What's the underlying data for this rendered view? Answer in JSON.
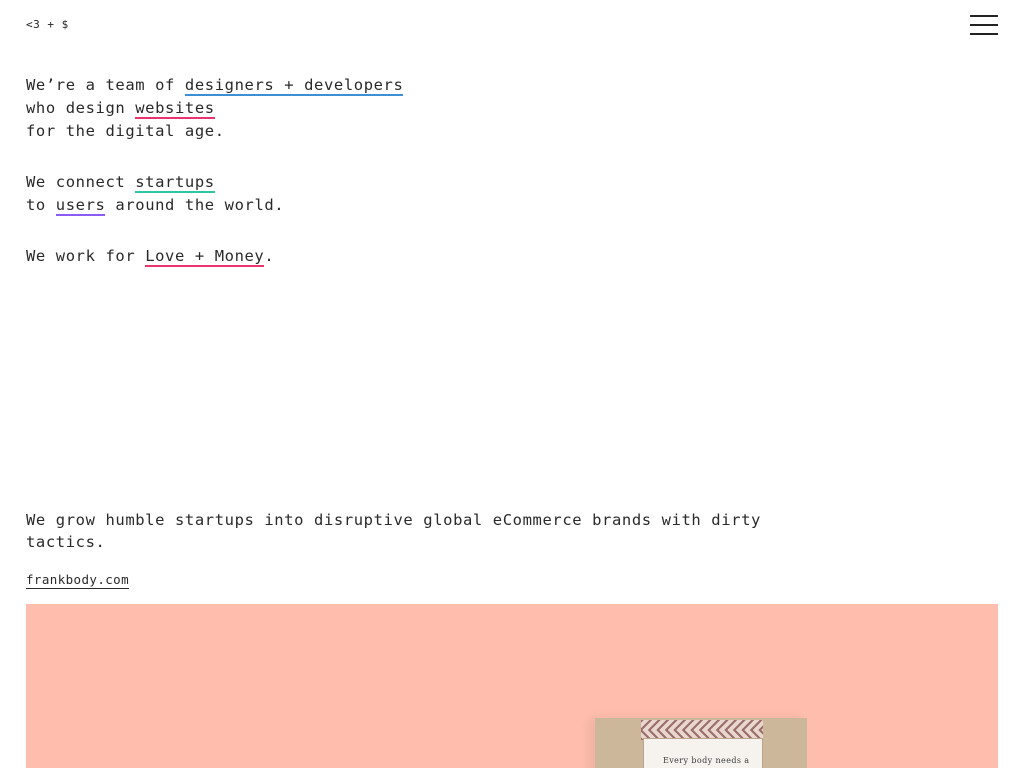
{
  "header": {
    "logo_text": "<3 + $",
    "menu_icon": "hamburger-menu-icon"
  },
  "intro": {
    "p1": {
      "l1_pre": "We’re a team of ",
      "l1_link": "designers + developers",
      "l2_pre": "who design ",
      "l2_link": "websites",
      "l3": "for the digital age."
    },
    "p2": {
      "l1_pre": "We connect ",
      "l1_link": "startups",
      "l2_pre": "to ",
      "l2_link": "users",
      "l2_post": " around the world."
    },
    "p3": {
      "pre": "We work for ",
      "link": "Love + Money",
      "post": "."
    }
  },
  "colors": {
    "designers_developers": "#3d8fd6",
    "websites": "#e8356e",
    "startups": "#2cc6a3",
    "users": "#8c5bf5",
    "love_money": "#e8356e",
    "hero_background": "#febdad"
  },
  "showcase": {
    "tagline": "We grow humble startups into disruptive global eCommerce brands with dirty tactics.",
    "link": "frankbody.com",
    "product_label": "Every body needs a"
  }
}
